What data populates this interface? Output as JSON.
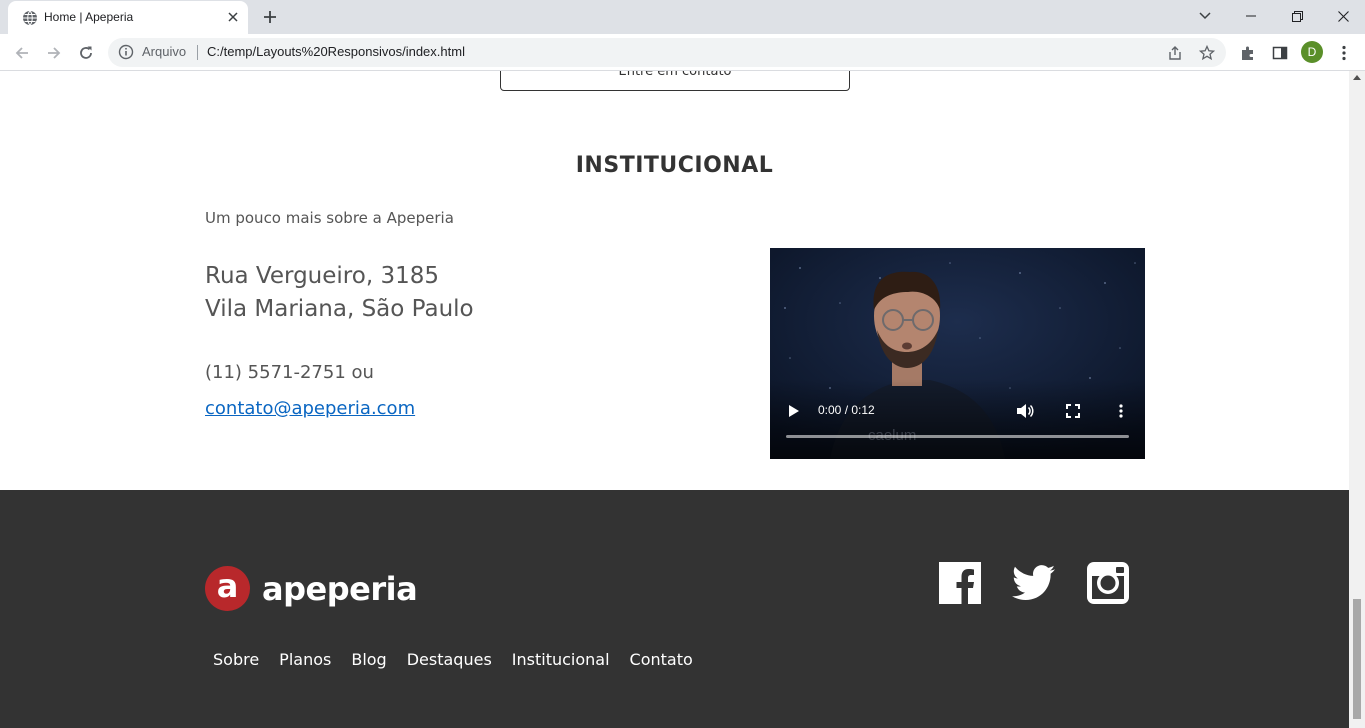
{
  "browser": {
    "tab_title": "Home | Apeperia",
    "address_scheme": "Arquivo",
    "address_url": "C:/temp/Layouts%20Responsivos/index.html",
    "profile_initial": "D",
    "profile_color": "#5a8f29"
  },
  "page": {
    "cta_label": "Entre em contato",
    "institutional": {
      "title": "INSTITUCIONAL",
      "subtitle": "Um pouco mais sobre a Apeperia",
      "address_line1": "Rua Vergueiro, 3185",
      "address_line2": "Vila Mariana, São Paulo",
      "phone": "(11) 5571-2751 ou",
      "email": "contato@apeperia.com"
    },
    "video": {
      "time": "0:00 / 0:12",
      "progress": 0
    }
  },
  "footer": {
    "logo_mark": "a",
    "logo_text": "apeperia",
    "social": [
      "facebook-icon",
      "twitter-icon",
      "instagram-icon"
    ],
    "nav": [
      "Sobre",
      "Planos",
      "Blog",
      "Destaques",
      "Institucional",
      "Contato"
    ],
    "background_color": "#333333",
    "brand_color": "#b8282b"
  }
}
